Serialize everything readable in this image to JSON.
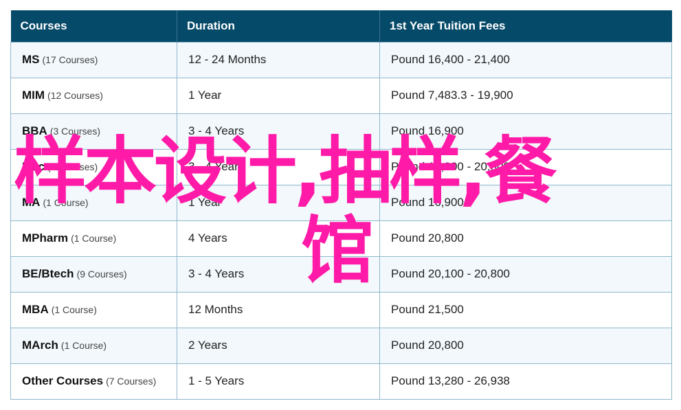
{
  "table": {
    "headers": [
      "Courses",
      "Duration",
      "1st Year Tuition Fees"
    ],
    "rows": [
      {
        "name": "MS",
        "count": "(17 Courses)",
        "duration": "12 - 24 Months",
        "fee": "Pound 16,400 - 21,400"
      },
      {
        "name": "MIM",
        "count": "(12 Courses)",
        "duration": "1 Year",
        "fee": "Pound 7,483.3 - 19,900"
      },
      {
        "name": "BBA",
        "count": "(3 Courses)",
        "duration": "3 - 4 Years",
        "fee": "Pound 16,900"
      },
      {
        "name": "BSc",
        "count": "(4 Courses)",
        "duration": "3 - 4 Years",
        "fee": "Pound 16,900 - 20,800"
      },
      {
        "name": "MA",
        "count": "(1 Course)",
        "duration": "1 Year",
        "fee": "Pound 16,900"
      },
      {
        "name": "MPharm",
        "count": "(1 Course)",
        "duration": "4 Years",
        "fee": "Pound 20,800"
      },
      {
        "name": "BE/Btech",
        "count": "(9 Courses)",
        "duration": "3 - 4 Years",
        "fee": "Pound 20,100 - 20,800"
      },
      {
        "name": "MBA",
        "count": "(1 Course)",
        "duration": "12 Months",
        "fee": "Pound 21,500"
      },
      {
        "name": "MArch",
        "count": "(1 Course)",
        "duration": "2 Years",
        "fee": "Pound 20,800"
      },
      {
        "name": "Other Courses",
        "count": "(7 Courses)",
        "duration": "1 - 5 Years",
        "fee": "Pound 13,280 - 26,938"
      }
    ]
  },
  "overlay": {
    "line1": "样本设计,抽样,餐",
    "line2": "馆",
    "color": "#ff1aa8"
  },
  "colors": {
    "header_bg": "#064a69",
    "row_alt_bg": "#f2f8fc",
    "border": "#8fb7cb"
  }
}
